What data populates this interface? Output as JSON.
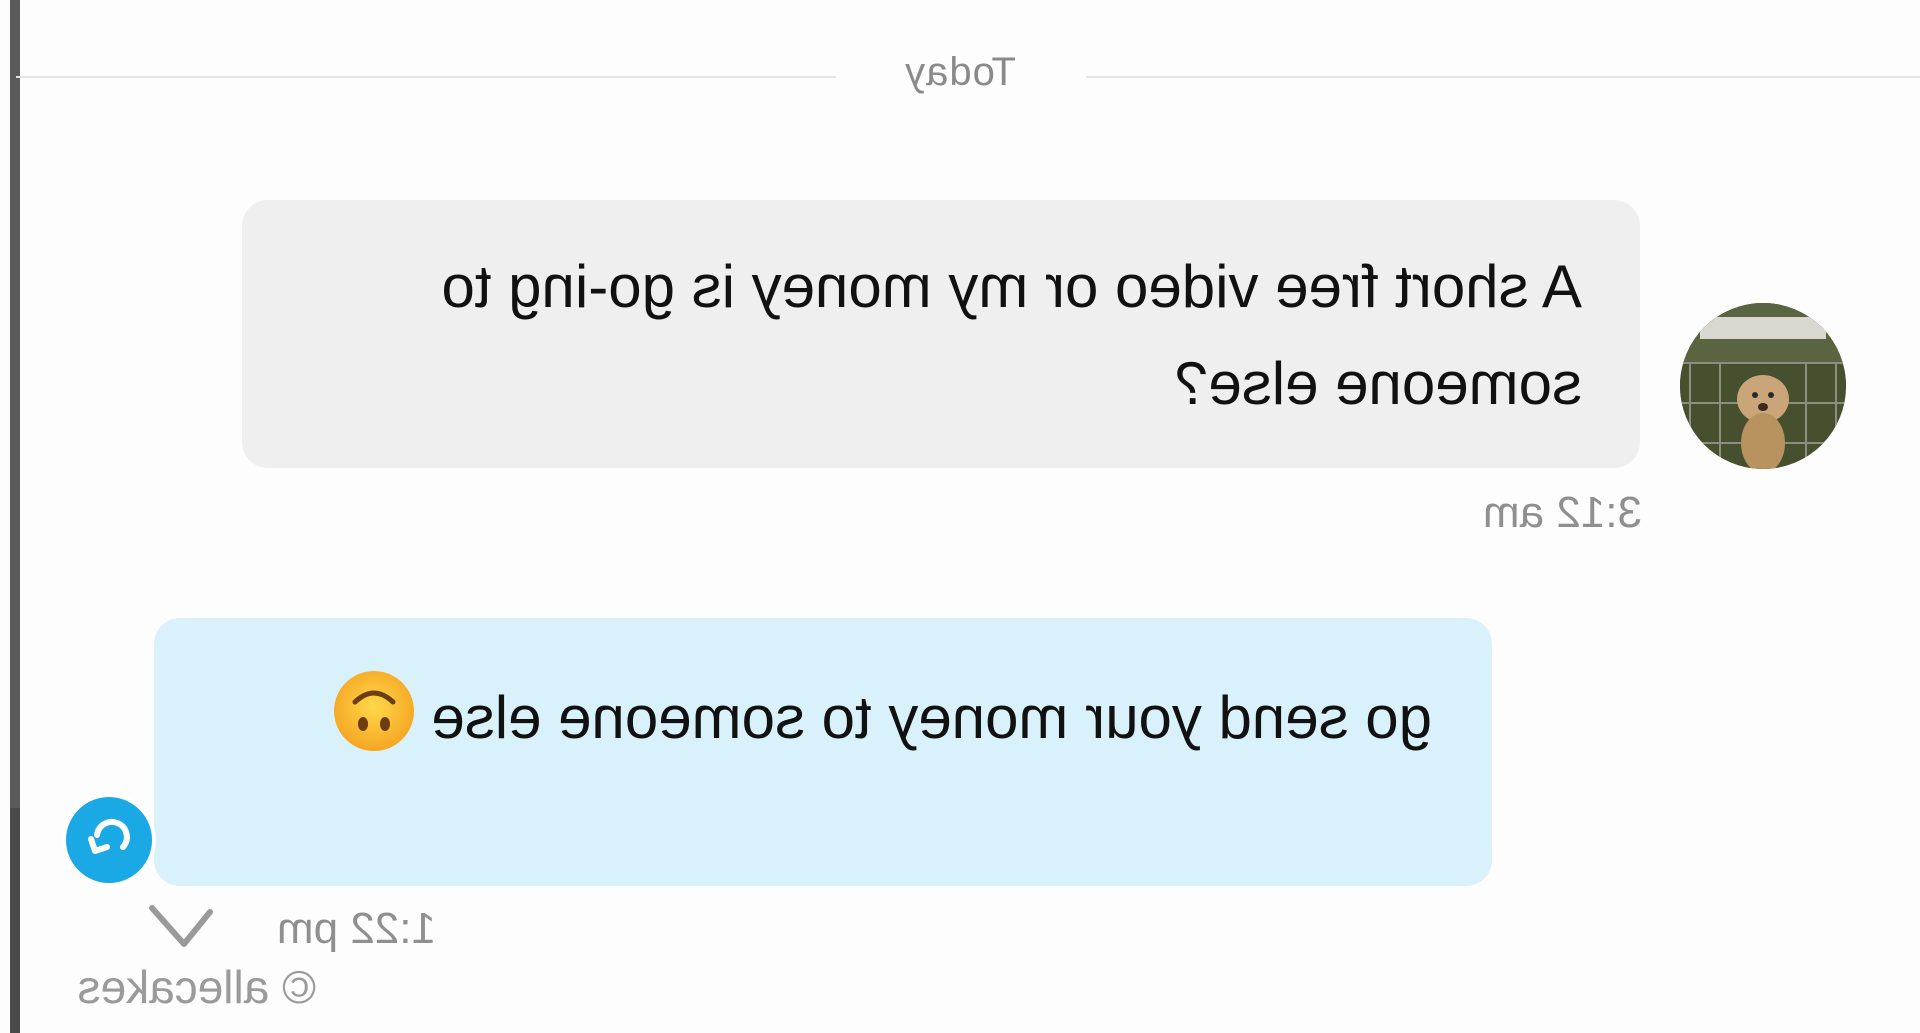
{
  "chat": {
    "date_divider": "Today",
    "messages": [
      {
        "direction": "incoming",
        "text": "A short free video or my money is go-ing to someone else?",
        "time": "3:12 am"
      },
      {
        "direction": "outgoing",
        "text": "go send your money to someone else",
        "emoji": "upside-down-face",
        "time": "1:22 pm"
      }
    ]
  },
  "watermark": "© allecakes",
  "icons": {
    "avatar": "dog-photo-avatar",
    "forward": "forward-arrow-icon",
    "delivered": "check-icon"
  },
  "colors": {
    "incoming_bubble": "#efefef",
    "outgoing_bubble": "#d9f1fb",
    "accent": "#1aa9e4",
    "timestamp": "#8f8f8f"
  }
}
